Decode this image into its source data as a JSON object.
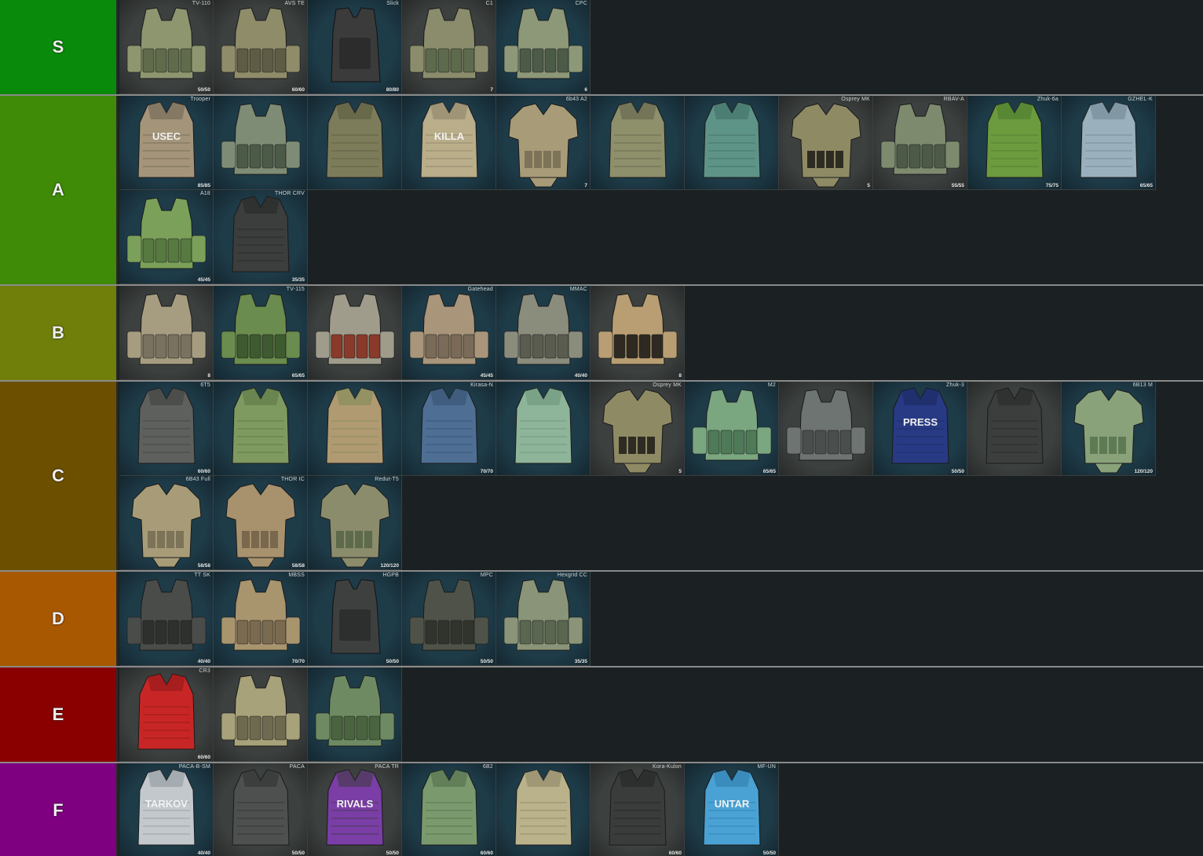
{
  "tiers": [
    {
      "label": "S",
      "color": "#0a8a0a",
      "height": 120,
      "items": [
        {
          "name": "TV-110",
          "dur": "50/50",
          "bg": "#3c403f",
          "vest": "#8e9670",
          "accent": "#5f6b4a",
          "sil": "carrier",
          "text": ""
        },
        {
          "name": "AVS TE",
          "dur": "60/60",
          "bg": "#3c403f",
          "vest": "#8f8c6a",
          "accent": "#5e5c44",
          "sil": "carrier",
          "text": ""
        },
        {
          "name": "Slick",
          "dur": "80/80",
          "bg": "#1e3b48",
          "vest": "#3a3b3a",
          "accent": "#262726",
          "sil": "plate",
          "text": ""
        },
        {
          "name": "C1",
          "dur": "7",
          "bg": "#3c403f",
          "vest": "#8a8c6c",
          "accent": "#5d6a4c",
          "sil": "carrier",
          "text": ""
        },
        {
          "name": "CPC",
          "dur": "6",
          "bg": "#1e3b48",
          "vest": "#8c9878",
          "accent": "#4c5a48",
          "sil": "carrier",
          "text": ""
        }
      ]
    },
    {
      "label": "A",
      "color": "#3f8a06",
      "height": 240,
      "items": [
        {
          "name": "Trooper",
          "dur": "85/85",
          "bg": "#1e3b48",
          "vest": "#a4957a",
          "accent": "#6c6250",
          "sil": "vest",
          "text": "USEC"
        },
        {
          "name": "",
          "dur": "",
          "bg": "#1e3b48",
          "vest": "#7e8c76",
          "accent": "#4c5a48",
          "sil": "carrier",
          "text": ""
        },
        {
          "name": "",
          "dur": "",
          "bg": "#1e3b48",
          "vest": "#7d7c5a",
          "accent": "#585840",
          "sil": "vest",
          "text": ""
        },
        {
          "name": "",
          "dur": "",
          "bg": "#1e3b48",
          "vest": "#b9ad8a",
          "accent": "#8a8066",
          "sil": "vest",
          "text": "KILLA"
        },
        {
          "name": "6b43 A2",
          "dur": "7",
          "bg": "#1e3b48",
          "vest": "#a89c78",
          "accent": "#7d7358",
          "sil": "armored",
          "text": ""
        },
        {
          "name": "",
          "dur": "",
          "bg": "#1e3b48",
          "vest": "#8e8f6b",
          "accent": "#5e5f48",
          "sil": "vest",
          "text": ""
        },
        {
          "name": "",
          "dur": "",
          "bg": "#1e3b48",
          "vest": "#5e9488",
          "accent": "#3f6b62",
          "sil": "vest",
          "text": ""
        },
        {
          "name": "Osprey MK",
          "dur": "5",
          "bg": "#3c403f",
          "vest": "#8e8a64",
          "accent": "#2e2c22",
          "sil": "armored",
          "text": ""
        },
        {
          "name": "RBAV-A",
          "dur": "55/55",
          "bg": "#3c403f",
          "vest": "#7d8a6e",
          "accent": "#4d5a48",
          "sil": "carrier",
          "text": ""
        },
        {
          "name": "Zhuk-6a",
          "dur": "75/75",
          "bg": "#1e3b48",
          "vest": "#6c9a3e",
          "accent": "#4b7a2e",
          "sil": "vest",
          "text": ""
        },
        {
          "name": "GZHEL-K",
          "dur": "65/65",
          "bg": "#1e3b48",
          "vest": "#9ab0bc",
          "accent": "#6e8590",
          "sil": "vest",
          "text": ""
        },
        {
          "name": "A18",
          "dur": "45/45",
          "bg": "#1e3b48",
          "vest": "#7aa05a",
          "accent": "#567a40",
          "sil": "carrier",
          "text": ""
        },
        {
          "name": "THOR CRV",
          "dur": "35/35",
          "bg": "#1e3b48",
          "vest": "#3c3d3d",
          "accent": "#252626",
          "sil": "vest",
          "text": ""
        }
      ]
    },
    {
      "label": "B",
      "color": "#6f7f0a",
      "height": 120,
      "items": [
        {
          "name": "",
          "dur": "8",
          "bg": "#3c403f",
          "vest": "#a69c80",
          "accent": "#7a7260",
          "sil": "carrier",
          "text": ""
        },
        {
          "name": "TV-115",
          "dur": "65/65",
          "bg": "#1e3b48",
          "vest": "#6a8c4e",
          "accent": "#3e5a30",
          "sil": "carrier",
          "text": ""
        },
        {
          "name": "",
          "dur": "",
          "bg": "#3c403f",
          "vest": "#a09c8c",
          "accent": "#8a3a2a",
          "sil": "carrier",
          "text": ""
        },
        {
          "name": "Gatehead",
          "dur": "45/45",
          "bg": "#1e3b48",
          "vest": "#a8957a",
          "accent": "#7a6a58",
          "sil": "carrier",
          "text": ""
        },
        {
          "name": "MMAC",
          "dur": "40/40",
          "bg": "#1e3b48",
          "vest": "#8a8c7c",
          "accent": "#5a5c50",
          "sil": "carrier",
          "text": ""
        },
        {
          "name": "",
          "dur": "8",
          "bg": "#3c403f",
          "vest": "#b89e72",
          "accent": "#2e2a22",
          "sil": "carrier",
          "text": ""
        }
      ]
    },
    {
      "label": "C",
      "color": "#6c5000",
      "height": 240,
      "items": [
        {
          "name": "6T5",
          "dur": "60/60",
          "bg": "#1e3b48",
          "vest": "#5e605e",
          "accent": "#3e403e",
          "sil": "vest",
          "text": ""
        },
        {
          "name": "",
          "dur": "",
          "bg": "#1e3b48",
          "vest": "#7e9a60",
          "accent": "#5a7444",
          "sil": "vest",
          "text": ""
        },
        {
          "name": "",
          "dur": "",
          "bg": "#1e3b48",
          "vest": "#b09a72",
          "accent": "#7e8a58",
          "sil": "vest",
          "text": ""
        },
        {
          "name": "Kirasa-N",
          "dur": "70/70",
          "bg": "#1e3b48",
          "vest": "#4e6e94",
          "accent": "#34506e",
          "sil": "vest",
          "text": ""
        },
        {
          "name": "",
          "dur": "",
          "bg": "#1e3b48",
          "vest": "#8eb49a",
          "accent": "#6a9478",
          "sil": "vest",
          "text": ""
        },
        {
          "name": "Osprey MK",
          "dur": "5",
          "bg": "#3c403f",
          "vest": "#8e8a64",
          "accent": "#2e2c22",
          "sil": "armored",
          "text": ""
        },
        {
          "name": "M2",
          "dur": "65/65",
          "bg": "#1e3b48",
          "vest": "#7aa680",
          "accent": "#4f7a58",
          "sil": "carrier",
          "text": ""
        },
        {
          "name": "",
          "dur": "",
          "bg": "#3c403f",
          "vest": "#6e7472",
          "accent": "#4a4e4c",
          "sil": "carrier",
          "text": ""
        },
        {
          "name": "Zhuk-3",
          "dur": "50/50",
          "bg": "#1e3b48",
          "vest": "#283a84",
          "accent": "#1a285e",
          "sil": "vest",
          "text": "PRESS"
        },
        {
          "name": "",
          "dur": "",
          "bg": "#3c403f",
          "vest": "#3c3e3e",
          "accent": "#262828",
          "sil": "vest",
          "text": ""
        },
        {
          "name": "6B13 M",
          "dur": "120/120",
          "bg": "#1e3b48",
          "vest": "#8aa27a",
          "accent": "#5e7a54",
          "sil": "armored",
          "text": ""
        },
        {
          "name": "6B43 Full",
          "dur": "58/58",
          "bg": "#1e3b48",
          "vest": "#a89c78",
          "accent": "#7d7358",
          "sil": "armored",
          "text": ""
        },
        {
          "name": "THOR IC",
          "dur": "58/58",
          "bg": "#1e3b48",
          "vest": "#a8926e",
          "accent": "#7a684e",
          "sil": "armored",
          "text": ""
        },
        {
          "name": "Redut-T5",
          "dur": "120/120",
          "bg": "#1e3b48",
          "vest": "#8a8c6c",
          "accent": "#5d6a4c",
          "sil": "armored",
          "text": ""
        }
      ]
    },
    {
      "label": "D",
      "color": "#a85800",
      "height": 120,
      "items": [
        {
          "name": "TT SK",
          "dur": "40/40",
          "bg": "#1e3b48",
          "vest": "#4a4c4a",
          "accent": "#2e302e",
          "sil": "carrier",
          "text": ""
        },
        {
          "name": "MBSS",
          "dur": "70/70",
          "bg": "#1e3b48",
          "vest": "#a8956e",
          "accent": "#7a6a50",
          "sil": "carrier",
          "text": ""
        },
        {
          "name": "HGPB",
          "dur": "50/50",
          "bg": "#1e3b48",
          "vest": "#3e4040",
          "accent": "#262828",
          "sil": "plate",
          "text": ""
        },
        {
          "name": "MPC",
          "dur": "50/50",
          "bg": "#1e3b48",
          "vest": "#4e5248",
          "accent": "#30342c",
          "sil": "carrier",
          "text": ""
        },
        {
          "name": "Hexgrid CC",
          "dur": "35/35",
          "bg": "#1e3b48",
          "vest": "#8a9478",
          "accent": "#5a6650",
          "sil": "carrier",
          "text": ""
        }
      ]
    },
    {
      "label": "E",
      "color": "#8a0000",
      "height": 120,
      "items": [
        {
          "name": "CR3",
          "dur": "60/60",
          "bg": "#3c403f",
          "vest": "#c82626",
          "accent": "#8e1616",
          "sil": "vest",
          "text": ""
        },
        {
          "name": "",
          "dur": "",
          "bg": "#3c403f",
          "vest": "#a8a27a",
          "accent": "#6e6a50",
          "sil": "carrier",
          "text": ""
        },
        {
          "name": "",
          "dur": "",
          "bg": "#1e3b48",
          "vest": "#6e8a62",
          "accent": "#4a6440",
          "sil": "carrier",
          "text": ""
        }
      ]
    },
    {
      "label": "F",
      "color": "#7e0080",
      "height": 120,
      "items": [
        {
          "name": "PACA-B-SM",
          "dur": "40/40",
          "bg": "#1e3b48",
          "vest": "#c2c8cc",
          "accent": "#8e969a",
          "sil": "vest",
          "text": "TARKOV"
        },
        {
          "name": "PACA",
          "dur": "50/50",
          "bg": "#3c403f",
          "vest": "#4e5050",
          "accent": "#2e3030",
          "sil": "vest",
          "text": ""
        },
        {
          "name": "PACA TR",
          "dur": "50/50",
          "bg": "#3c403f",
          "vest": "#7a3ea6",
          "accent": "#3a3a3a",
          "sil": "vest",
          "text": "RIVALS"
        },
        {
          "name": "6B2",
          "dur": "60/60",
          "bg": "#1e3b48",
          "vest": "#7a9a6e",
          "accent": "#4e6a48",
          "sil": "vest",
          "text": ""
        },
        {
          "name": "",
          "dur": "",
          "bg": "#1e3b48",
          "vest": "#bab28a",
          "accent": "#8a8266",
          "sil": "vest",
          "text": ""
        },
        {
          "name": "Kora-Kulon",
          "dur": "60/60",
          "bg": "#3c403f",
          "vest": "#3a3c3c",
          "accent": "#222424",
          "sil": "vest",
          "text": ""
        },
        {
          "name": "MF-UN",
          "dur": "50/50",
          "bg": "#1e3b48",
          "vest": "#4aa2d4",
          "accent": "#2e7aaa",
          "sil": "vest",
          "text": "UNTAR"
        }
      ]
    }
  ]
}
